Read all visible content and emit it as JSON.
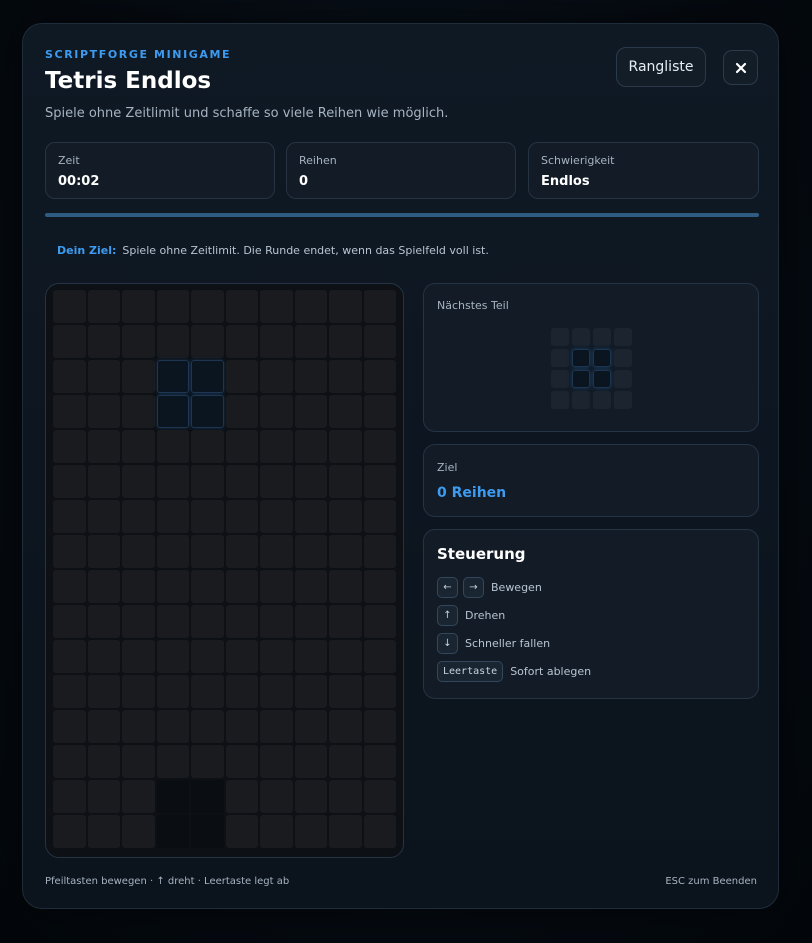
{
  "header": {
    "kicker": "SCRIPTFORGE MINIGAME",
    "title": "Tetris Endlos",
    "subtitle": "Spiele ohne Zeitlimit und schaffe so viele Reihen wie möglich.",
    "leaderboard_label": "Rangliste",
    "close_icon": "close-icon"
  },
  "stats": [
    {
      "label": "Zeit",
      "value": "00:02"
    },
    {
      "label": "Reihen",
      "value": "0"
    },
    {
      "label": "Schwierigkeit",
      "value": "Endlos"
    }
  ],
  "progress": {
    "fraction": 1.0
  },
  "goal": {
    "label": "Dein Ziel:",
    "text": "Spiele ohne Zeitlimit. Die Runde endet, wenn das Spielfeld voll ist."
  },
  "board": {
    "cols": 10,
    "rows": 16,
    "active_piece": [
      [
        3,
        4
      ],
      [
        3,
        5
      ],
      [
        4,
        4
      ],
      [
        4,
        5
      ]
    ],
    "void_cells": [
      [
        15,
        4
      ],
      [
        15,
        5
      ],
      [
        16,
        4
      ],
      [
        16,
        5
      ]
    ]
  },
  "next_piece": {
    "label": "Nächstes Teil",
    "cells": [
      [
        2,
        2
      ],
      [
        2,
        3
      ],
      [
        3,
        2
      ],
      [
        3,
        3
      ]
    ]
  },
  "target": {
    "label": "Ziel",
    "value": "0 Reihen"
  },
  "controls": {
    "title": "Steuerung",
    "rows": [
      {
        "keys": [
          "←",
          "→"
        ],
        "label": "Bewegen"
      },
      {
        "keys": [
          "↑"
        ],
        "label": "Drehen"
      },
      {
        "keys": [
          "↓"
        ],
        "label": "Schneller fallen"
      },
      {
        "keys": [
          "Leertaste"
        ],
        "label": "Sofort ablegen"
      }
    ]
  },
  "footer": {
    "left": "Pfeiltasten bewegen · ↑ dreht · Leertaste legt ab",
    "right": "ESC zum Beenden"
  },
  "colors": {
    "accent": "#3d9bf0",
    "background": "#0b131c"
  }
}
